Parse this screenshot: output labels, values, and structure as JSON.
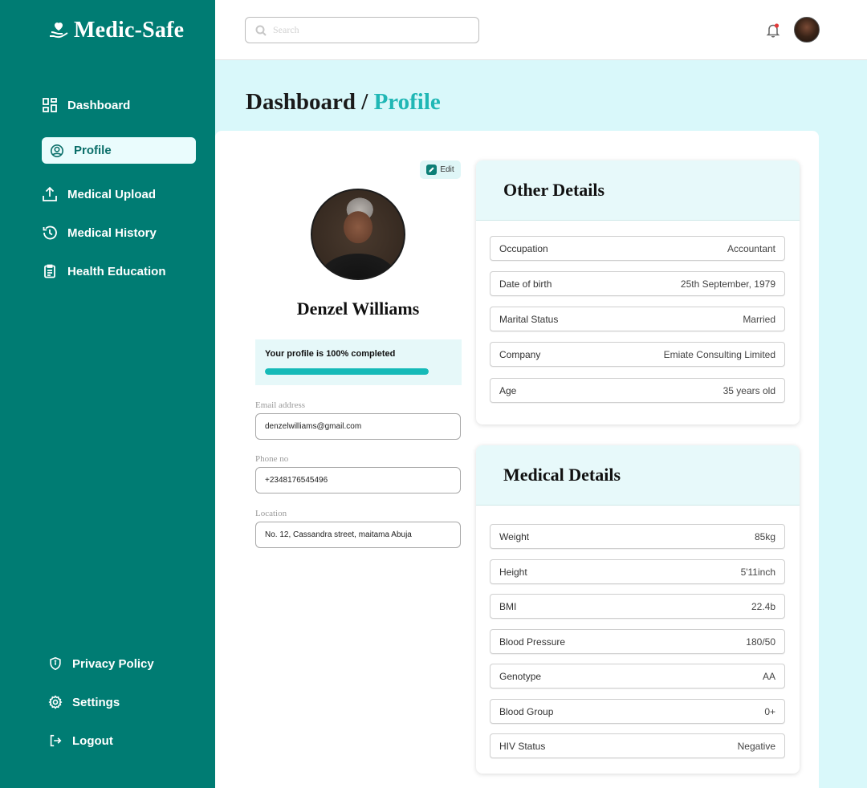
{
  "app": {
    "name": "Medic-Safe"
  },
  "sidebar": {
    "items": [
      {
        "label": "Dashboard",
        "icon": "dashboard-icon"
      },
      {
        "label": "Profile",
        "icon": "user-circle-icon",
        "active": true
      },
      {
        "label": "Medical Upload",
        "icon": "upload-icon"
      },
      {
        "label": "Medical History",
        "icon": "history-icon"
      },
      {
        "label": "Health Education",
        "icon": "clipboard-icon"
      }
    ],
    "bottom": [
      {
        "label": "Privacy Policy",
        "icon": "shield-icon"
      },
      {
        "label": "Settings",
        "icon": "gear-icon"
      },
      {
        "label": "Logout",
        "icon": "logout-icon"
      }
    ]
  },
  "topbar": {
    "search_placeholder": "Search"
  },
  "breadcrumb": {
    "root": "Dashboard",
    "separator": " / ",
    "current": "Profile"
  },
  "profile": {
    "edit_label": "Edit",
    "name": "Denzel Williams",
    "completion_text": "Your profile is 100% completed",
    "completion_fraction": 1.0,
    "email_label": "Email address",
    "email": "denzelwilliams@gmail.com",
    "phone_label": "Phone no",
    "phone": "+2348176545496",
    "location_label": "Location",
    "location": "No. 12, Cassandra street, maitama Abuja"
  },
  "other_details": {
    "title": "Other Details",
    "rows": [
      {
        "label": "Occupation",
        "value": "Accountant"
      },
      {
        "label": "Date of birth",
        "value": "25th September, 1979"
      },
      {
        "label": "Marital Status",
        "value": "Married"
      },
      {
        "label": "Company",
        "value": "Emiate Consulting Limited"
      },
      {
        "label": "Age",
        "value": "35 years old"
      }
    ]
  },
  "medical_details": {
    "title": "Medical Details",
    "rows": [
      {
        "label": "Weight",
        "value": "85kg"
      },
      {
        "label": "Height",
        "value": "5'11inch"
      },
      {
        "label": "BMI",
        "value": "22.4b"
      },
      {
        "label": "Blood Pressure",
        "value": "180/50"
      },
      {
        "label": "Genotype",
        "value": "AA"
      },
      {
        "label": "Blood Group",
        "value": "0+"
      },
      {
        "label": "HIV Status",
        "value": "Negative"
      }
    ]
  },
  "colors": {
    "sidebar": "#007c73",
    "accent": "#20b7b5",
    "background": "#d9f8fa"
  }
}
